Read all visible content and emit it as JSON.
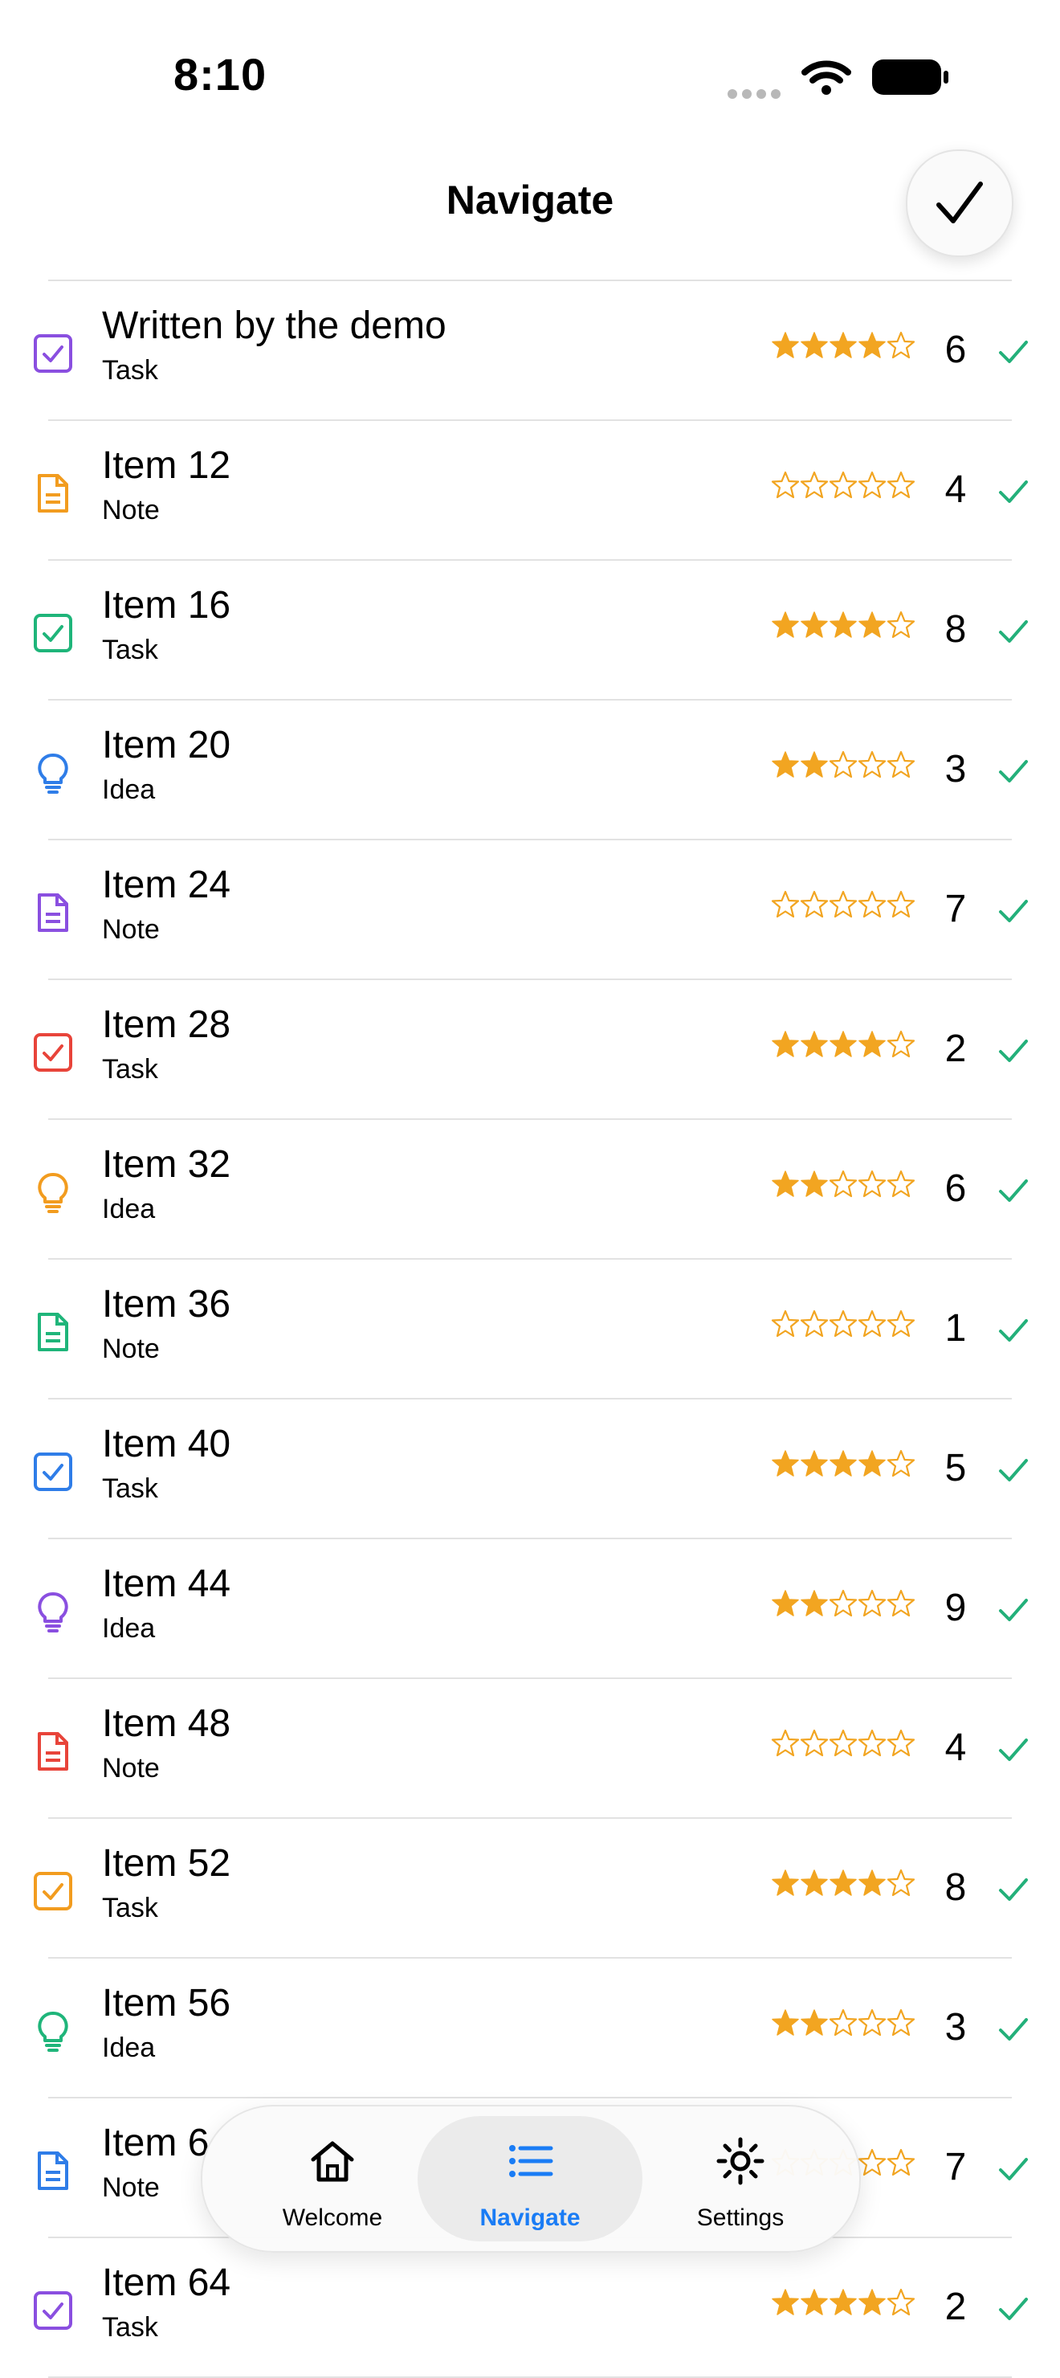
{
  "status": {
    "time": "8:10"
  },
  "header": {
    "title": "Navigate"
  },
  "items": [
    {
      "title": "Written by the demo",
      "type": "Task",
      "rating": 4,
      "count": "6",
      "color": "#8a4fe0"
    },
    {
      "title": "Item 12",
      "type": "Note",
      "rating": 0,
      "count": "4",
      "color": "#f29c1f"
    },
    {
      "title": "Item 16",
      "type": "Task",
      "rating": 4,
      "count": "8",
      "color": "#1fb57a"
    },
    {
      "title": "Item 20",
      "type": "Idea",
      "rating": 2,
      "count": "3",
      "color": "#2f7de8"
    },
    {
      "title": "Item 24",
      "type": "Note",
      "rating": 0,
      "count": "7",
      "color": "#8a4fe0"
    },
    {
      "title": "Item 28",
      "type": "Task",
      "rating": 4,
      "count": "2",
      "color": "#e8443a"
    },
    {
      "title": "Item 32",
      "type": "Idea",
      "rating": 2,
      "count": "6",
      "color": "#f29c1f"
    },
    {
      "title": "Item 36",
      "type": "Note",
      "rating": 0,
      "count": "1",
      "color": "#1fb57a"
    },
    {
      "title": "Item 40",
      "type": "Task",
      "rating": 4,
      "count": "5",
      "color": "#2f7de8"
    },
    {
      "title": "Item 44",
      "type": "Idea",
      "rating": 2,
      "count": "9",
      "color": "#8a4fe0"
    },
    {
      "title": "Item 48",
      "type": "Note",
      "rating": 0,
      "count": "4",
      "color": "#e8443a"
    },
    {
      "title": "Item 52",
      "type": "Task",
      "rating": 4,
      "count": "8",
      "color": "#f29c1f"
    },
    {
      "title": "Item 56",
      "type": "Idea",
      "rating": 2,
      "count": "3",
      "color": "#1fb57a"
    },
    {
      "title": "Item 6",
      "type": "Note",
      "rating": 0,
      "count": "7",
      "color": "#2f7de8"
    },
    {
      "title": "Item 64",
      "type": "Task",
      "rating": 4,
      "count": "2",
      "color": "#8a4fe0"
    }
  ],
  "colors": {
    "star": "#f2a521",
    "check": "#23b07a",
    "accent": "#1a7cf5"
  },
  "tabs": [
    {
      "label": "Welcome",
      "icon": "house-icon",
      "active": false
    },
    {
      "label": "Navigate",
      "icon": "list-icon",
      "active": true
    },
    {
      "label": "Settings",
      "icon": "sun-icon",
      "active": false
    }
  ]
}
